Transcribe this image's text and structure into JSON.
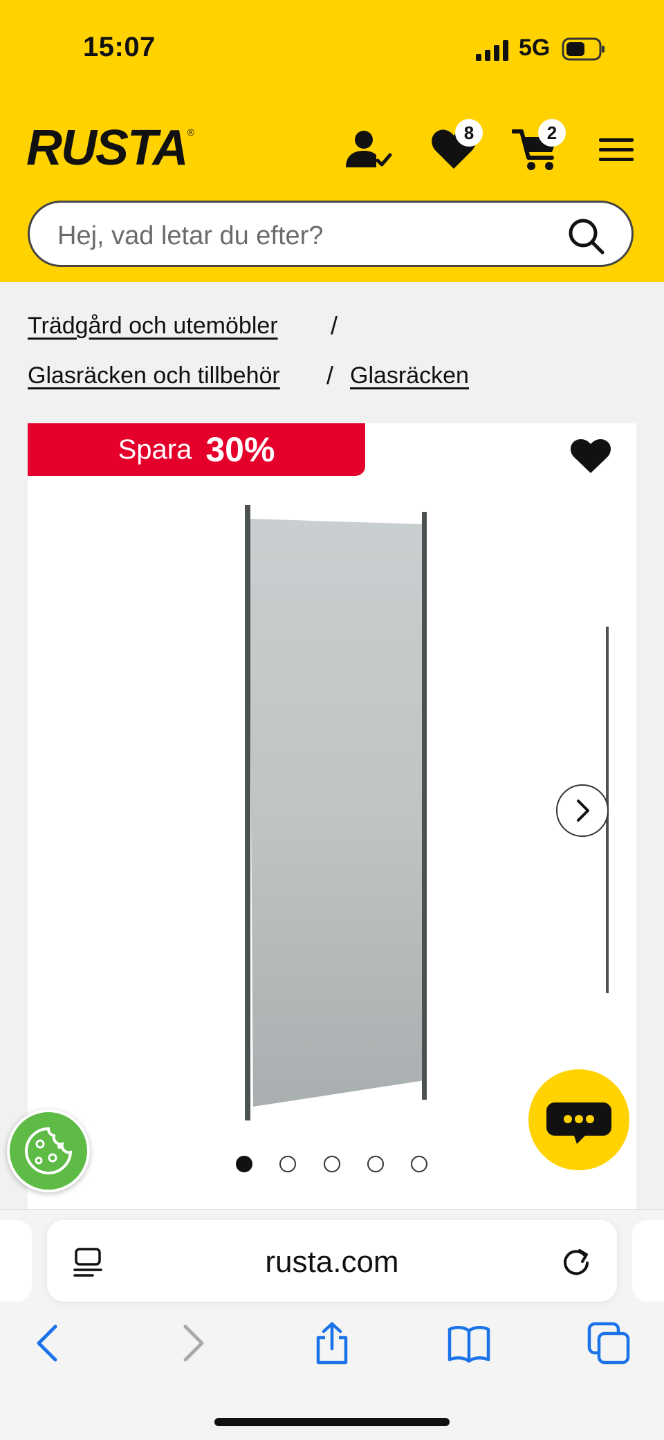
{
  "status_bar": {
    "time": "15:07",
    "network": "5G"
  },
  "header": {
    "logo_text": "RUSTA",
    "logo_mark": "®",
    "wishlist_count": "8",
    "cart_count": "2",
    "icons": [
      "account-check-icon",
      "heart-icon",
      "cart-icon",
      "menu-icon"
    ]
  },
  "search": {
    "placeholder": "Hej, vad letar du efter?"
  },
  "breadcrumb": {
    "items": [
      "Trädgård och utemöbler",
      "Glasräcken och tillbehör",
      "Glasräcken"
    ],
    "separator": "/"
  },
  "product": {
    "sale_label": "Spara",
    "sale_percent": "30%",
    "carousel_total": 5,
    "carousel_active": 1
  },
  "browser": {
    "url": "rusta.com"
  },
  "colors": {
    "brand_yellow": "#ffd200",
    "sale_red": "#e4002b",
    "cookie_green": "#5dbb46",
    "safari_blue": "#1a73e8"
  }
}
